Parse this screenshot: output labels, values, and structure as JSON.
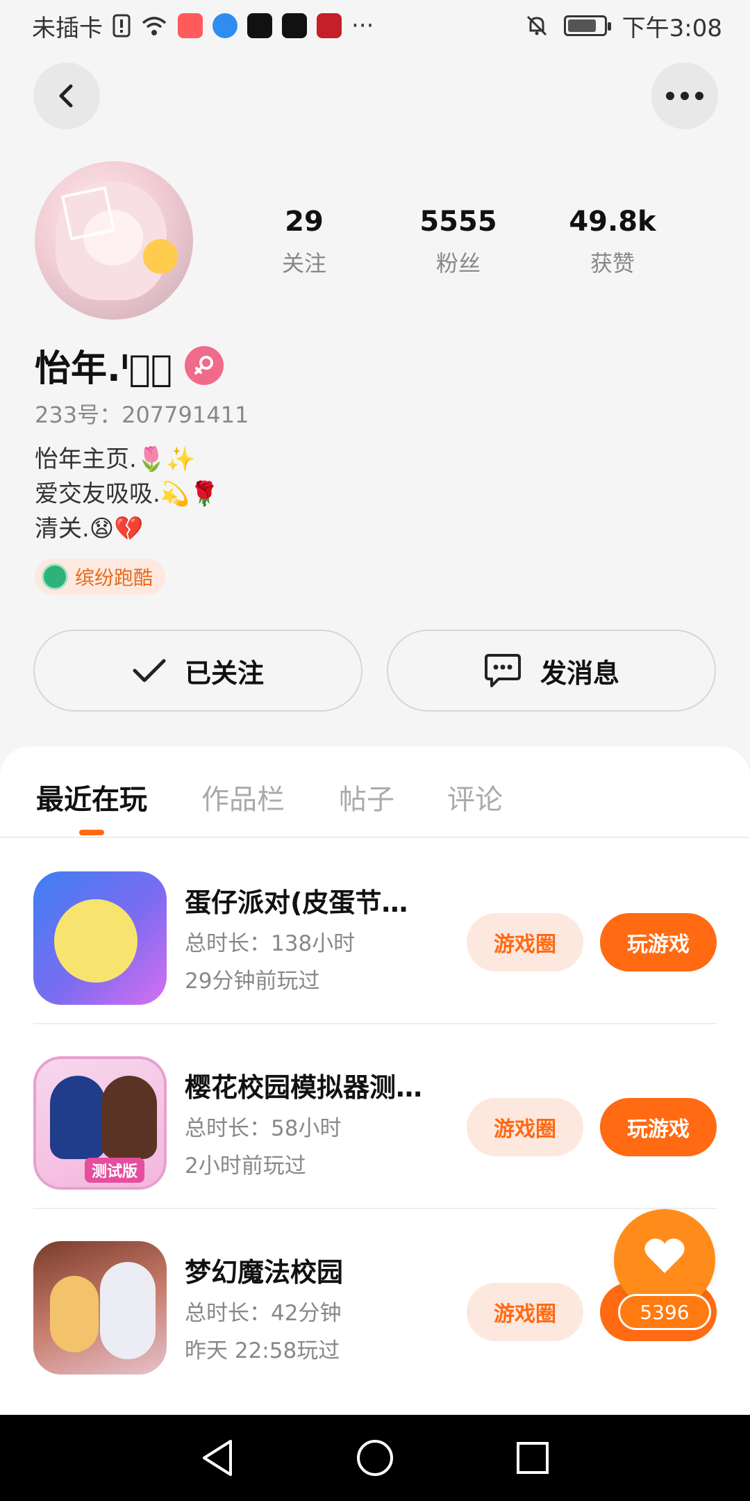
{
  "status_bar": {
    "carrier": "未插卡",
    "more": "···",
    "time": "下午3:08"
  },
  "profile": {
    "stats": [
      {
        "num": "29",
        "label": "关注"
      },
      {
        "num": "5555",
        "label": "粉丝"
      },
      {
        "num": "49.8k",
        "label": "获赞"
      }
    ],
    "nickname": "怡年.ᑊ͛ᑋ",
    "uid": "233号：207791411",
    "bio": [
      "怡年主页.🌷✨",
      "爱交友吸吸.💫🌹",
      "清关.😧💔"
    ],
    "tag": "缤纷跑酷",
    "follow_label": "已关注",
    "message_label": "发消息"
  },
  "tabs": [
    "最近在玩",
    "作品栏",
    "帖子",
    "评论"
  ],
  "games": [
    {
      "title": "蛋仔派对(皮蛋节…",
      "duration": "总时长：138小时",
      "last": "29分钟前玩过"
    },
    {
      "title": "樱花校园模拟器测…",
      "duration": "总时长：58小时",
      "last": "2小时前玩过",
      "badge": "测试版"
    },
    {
      "title": "梦幻魔法校园",
      "duration": "总时长：42分钟",
      "last": "昨天 22:58玩过"
    }
  ],
  "buttons": {
    "circle": "游戏圈",
    "play": "玩游戏"
  },
  "like_count": "5396",
  "colors": {
    "accent": "#ff6a13",
    "accent_light": "#fde8df",
    "gender": "#f06a8a"
  }
}
